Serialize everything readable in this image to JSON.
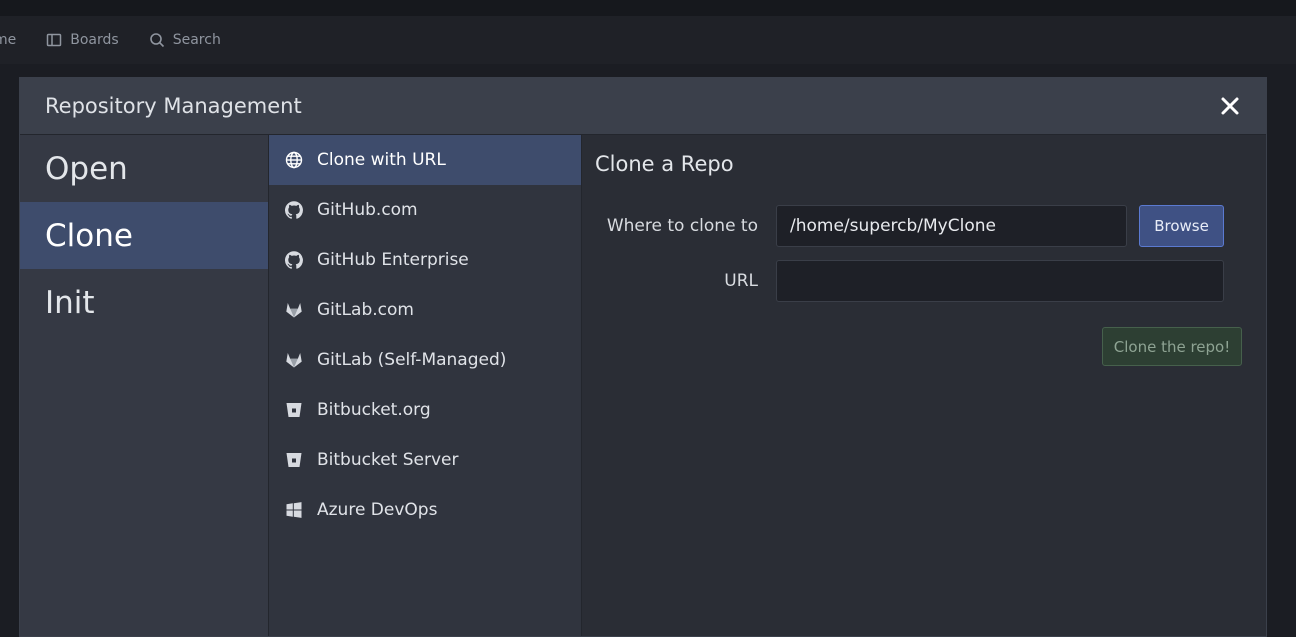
{
  "navbar": {
    "home_partial": "me",
    "boards": "Boards",
    "search": "Search"
  },
  "dialog": {
    "title": "Repository Management",
    "close_icon": "close-icon"
  },
  "modes": [
    {
      "label": "Open",
      "active": false
    },
    {
      "label": "Clone",
      "active": true
    },
    {
      "label": "Init",
      "active": false
    }
  ],
  "providers": [
    {
      "label": "Clone with URL",
      "icon": "globe-icon",
      "active": true
    },
    {
      "label": "GitHub.com",
      "icon": "github-icon",
      "active": false
    },
    {
      "label": "GitHub Enterprise",
      "icon": "github-icon",
      "active": false
    },
    {
      "label": "GitLab.com",
      "icon": "gitlab-icon",
      "active": false
    },
    {
      "label": "GitLab (Self-Managed)",
      "icon": "gitlab-icon",
      "active": false
    },
    {
      "label": "Bitbucket.org",
      "icon": "bitbucket-icon",
      "active": false
    },
    {
      "label": "Bitbucket Server",
      "icon": "bitbucket-icon",
      "active": false
    },
    {
      "label": "Azure DevOps",
      "icon": "windows-icon",
      "active": false
    }
  ],
  "form": {
    "title": "Clone a Repo",
    "where_label": "Where to clone to",
    "where_value": "/home/supercb/MyClone",
    "browse_label": "Browse",
    "url_label": "URL",
    "url_value": "",
    "clone_button": "Clone the repo!"
  },
  "colors": {
    "accent": "#3e4c6c",
    "browse": "#3f5184",
    "clone_button": "#2d3f33"
  }
}
